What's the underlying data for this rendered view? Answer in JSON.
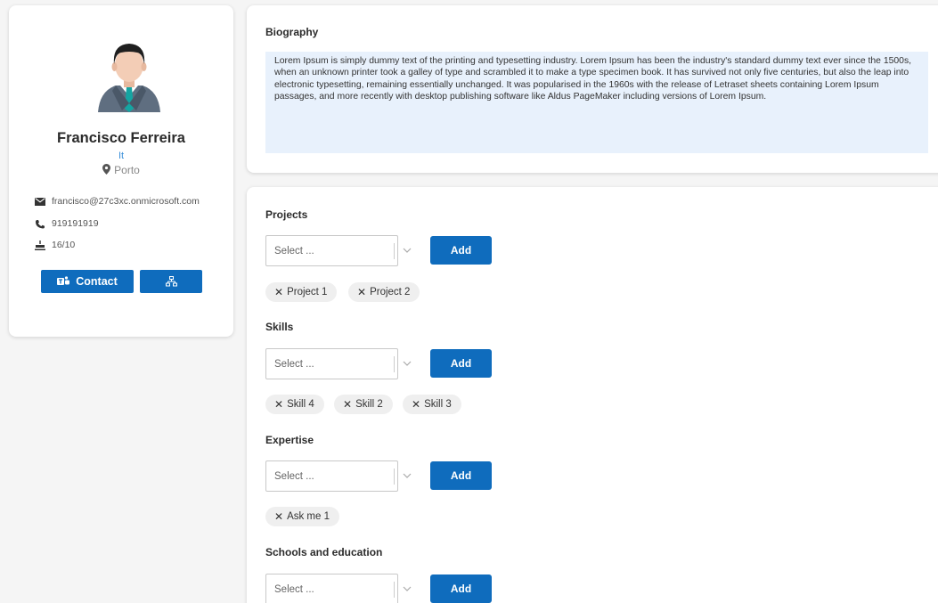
{
  "profile": {
    "name": "Francisco Ferreira",
    "department": "It",
    "location": "Porto",
    "email": "francisco@27c3xc.onmicrosoft.com",
    "phone": "919191919",
    "birthday": "16/10",
    "contact_label": "Contact"
  },
  "biography": {
    "title": "Biography",
    "text": "Lorem Ipsum is simply dummy text of the printing and typesetting industry. Lorem Ipsum has been the industry's standard dummy text ever since the 1500s, when an unknown printer took a galley of type and scrambled it to make a type specimen book. It has survived not only five centuries, but also the leap into electronic typesetting, remaining essentially unchanged. It was popularised in the 1960s with the release of Letraset sheets containing Lorem Ipsum passages, and more recently with desktop publishing software like Aldus PageMaker including versions of Lorem Ipsum."
  },
  "sections": [
    {
      "title": "Projects",
      "placeholder": "Select ...",
      "add_label": "Add",
      "chips": [
        "Project 1",
        "Project 2"
      ]
    },
    {
      "title": "Skills",
      "placeholder": "Select ...",
      "add_label": "Add",
      "chips": [
        "Skill 4",
        "Skill 2",
        "Skill 3"
      ]
    },
    {
      "title": "Expertise",
      "placeholder": "Select ...",
      "add_label": "Add",
      "chips": [
        "Ask me 1"
      ]
    },
    {
      "title": "Schools and education",
      "placeholder": "Select ...",
      "add_label": "Add",
      "chips": []
    }
  ],
  "chip_remove_glyph": "✕",
  "colors": {
    "accent": "#0f6cbd",
    "bio_background": "#e8f1fc",
    "department": "#3a8fd9"
  }
}
